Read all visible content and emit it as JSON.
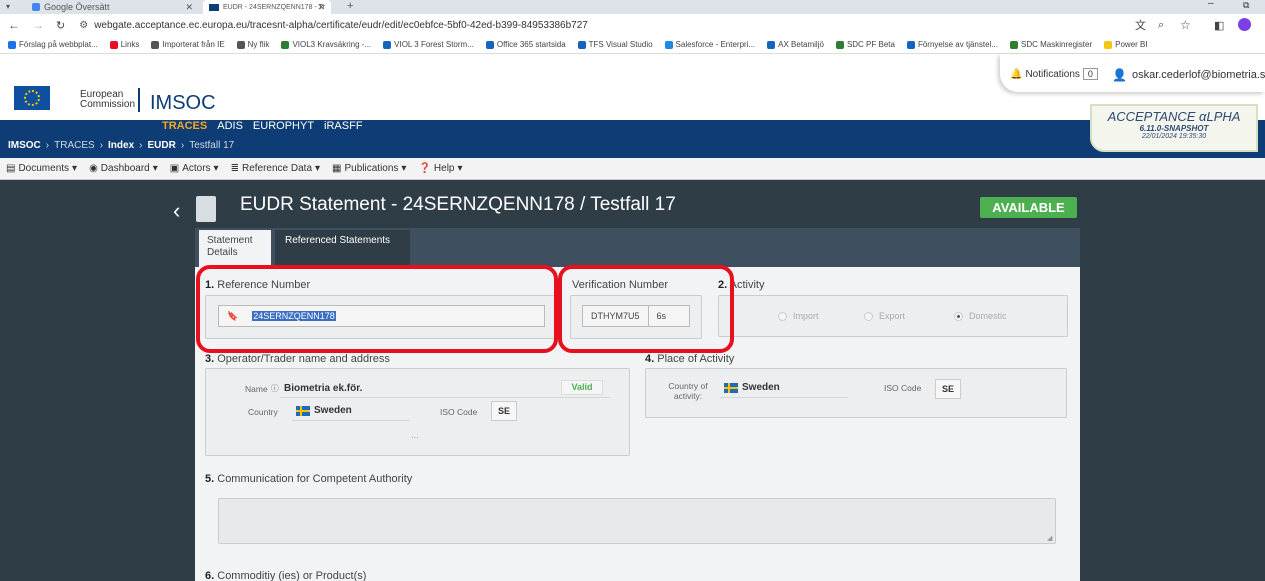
{
  "browser": {
    "tab_inactive": "Google Översätt",
    "tab_active": "EUDR - 24SERNZQENN178 - Tr",
    "url": "webgate.acceptance.ec.europa.eu/tracesnt-alpha/certificate/eudr/edit/ec0ebfce-5bf0-42ed-b399-84953386b727",
    "bookmarks": [
      {
        "label": "Förslag på webbplat...",
        "color": "#1a73e8"
      },
      {
        "label": "Links",
        "color": "#e8101f"
      },
      {
        "label": "Importerat från IE",
        "color": "#555"
      },
      {
        "label": "Ny flik",
        "color": "#555"
      },
      {
        "label": "VIOL3 Kravsäkring -...",
        "color": "#2e7d32"
      },
      {
        "label": "VIOL 3 Forest Storm...",
        "color": "#1565c0"
      },
      {
        "label": "Office 365 startsida",
        "color": "#1565c0"
      },
      {
        "label": "TFS Visual Studio",
        "color": "#1565c0"
      },
      {
        "label": "Salesforce - Enterpri...",
        "color": "#1e88e5"
      },
      {
        "label": "AX Betamiljö",
        "color": "#1565c0"
      },
      {
        "label": "SDC PF Beta",
        "color": "#2e7d32"
      },
      {
        "label": "Förnyelse av tjänstel...",
        "color": "#1565c0"
      },
      {
        "label": "SDC Maskinregister",
        "color": "#2e7d32"
      },
      {
        "label": "Power BI",
        "color": "#f2c811"
      }
    ]
  },
  "header": {
    "ec_line1": "European",
    "ec_line2": "Commission",
    "app_title": "IMSOC",
    "notifications_label": "Notifications",
    "notifications_count": "0",
    "user_email": "oskar.cederlof@biometria.se"
  },
  "env_badge": {
    "title": "ACCEPTANCE αLPHA",
    "version": "6.11.0-SNAPSHOT",
    "date": "22/01/2024 19:35:30"
  },
  "systems": [
    "TRACES",
    "ADIS",
    "EUROPHYT",
    "iRASFF"
  ],
  "breadcrumb": [
    "IMSOC",
    "TRACES",
    "Index",
    "EUDR",
    "Testfall 17"
  ],
  "menu": [
    "Documents",
    "Dashboard",
    "Actors",
    "Reference Data",
    "Publications",
    "Help"
  ],
  "page": {
    "title": "EUDR Statement - 24SERNZQENN178 / Testfall 17",
    "status": "AVAILABLE",
    "tabs": [
      "Statement Details",
      "Referenced Statements"
    ]
  },
  "section1": {
    "number": "1.",
    "title": "Reference Number",
    "value": "24SERNZQENN178"
  },
  "verification": {
    "title": "Verification Number",
    "value": "DTHYM7U5",
    "timer": "6s"
  },
  "section2": {
    "number": "2.",
    "title": "Activity",
    "options": [
      "Import",
      "Export",
      "Domestic"
    ],
    "selected": "Domestic"
  },
  "section3": {
    "number": "3.",
    "title": "Operator/Trader name and address",
    "name_label": "Name",
    "name_value": "Biometria ek.för.",
    "valid_badge": "Valid",
    "country_label": "Country",
    "country_value": "Sweden",
    "iso_label": "ISO Code",
    "iso_value": "SE",
    "more": "..."
  },
  "section4": {
    "number": "4.",
    "title": "Place of Activity",
    "country_label": "Country of activity:",
    "country_value": "Sweden",
    "iso_label": "ISO Code",
    "iso_value": "SE"
  },
  "section5": {
    "number": "5.",
    "title": "Communication for Competent Authority"
  },
  "section6": {
    "number": "6.",
    "title": "Commoditiy (ies) or Product(s)"
  },
  "colors": {
    "nav_blue": "#0e3d75",
    "traces_orange": "#f5a623",
    "status_green": "#4caf50",
    "highlight_red": "#e8101f"
  }
}
